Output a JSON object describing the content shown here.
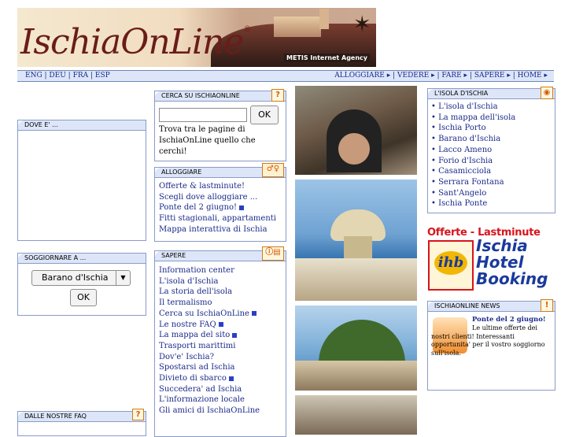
{
  "header": {
    "logo_text": "IschiaOnLine",
    "logo_reg": "®",
    "agency_label": "METIS Internet Agency"
  },
  "nav": {
    "languages": [
      "ENG",
      "DEU",
      "FRA",
      "ESP"
    ],
    "links": [
      "ALLOGGIARE",
      "VEDERE",
      "FARE",
      "SAPERE",
      "HOME"
    ]
  },
  "left": {
    "dove_title": "DOVE E' ...",
    "soggiornare_title": "SOGGIORNARE A ...",
    "soggiornare_selected": "Barano d'Ischia",
    "soggiornare_ok": "OK",
    "faq_title": "DALLE NOSTRE FAQ"
  },
  "search": {
    "title": "CERCA SU ISCHIAONLINE",
    "icon_glyph": "?",
    "value": "",
    "ok_label": "OK",
    "description": "Trova tra le pagine di IschiaOnLine quello che cerchi!"
  },
  "alloggiare": {
    "title": "ALLOGGIARE",
    "items": [
      {
        "label": "Offerte & lastminute!",
        "new": false
      },
      {
        "label": "Scegli dove alloggiare ...",
        "new": false
      },
      {
        "label": "Ponte del 2 giugno!",
        "new": true
      },
      {
        "label": "Fitti stagionali, appartamenti",
        "new": false
      },
      {
        "label": "Mappa interattiva di Ischia",
        "new": false
      }
    ]
  },
  "sapere": {
    "title": "SAPERE",
    "items": [
      {
        "label": "Information center",
        "new": false
      },
      {
        "label": "L'isola d'Ischia",
        "new": false
      },
      {
        "label": "La storia dell'isola",
        "new": false
      },
      {
        "label": "Il termalismo",
        "new": false
      },
      {
        "label": "Cerca su IschiaOnLine",
        "new": true
      },
      {
        "label": "Le nostre FAQ",
        "new": true
      },
      {
        "label": "La mappa del sito",
        "new": true
      },
      {
        "label": "Trasporti marittimi",
        "new": false
      },
      {
        "label": "Dov'e' Ischia?",
        "new": false
      },
      {
        "label": "Spostarsi ad Ischia",
        "new": false
      },
      {
        "label": "Divieto di sbarco",
        "new": true
      },
      {
        "label": "Succedera' ad Ischia",
        "new": false
      },
      {
        "label": "L'informazione locale",
        "new": false
      },
      {
        "label": "Gli amici di IschiaOnLine",
        "new": false
      }
    ]
  },
  "isola": {
    "title": "L'ISOLA D'ISCHIA",
    "items": [
      "L'isola d'Ischia",
      "La mappa dell'isola",
      "Ischia Porto",
      "Barano d'Ischia",
      "Lacco Ameno",
      "Forio d'Ischia",
      "Casamicciola",
      "Serrara Fontana",
      "Sant'Angelo",
      "Ischia Ponte"
    ]
  },
  "promo": {
    "headline": "Offerte - Lastminute",
    "logo_letters": "ihb",
    "line1": "Ischia",
    "line2": "Hotel",
    "line3": "Booking"
  },
  "news": {
    "title": "ISCHIAONLINE NEWS",
    "icon_glyph": "!",
    "headline": "Ponte del 2 giugno!",
    "text": "Le ultime offerte dei nostri clienti! Interessanti opportunita' per il vostro soggiorno sull'isola."
  },
  "colors": {
    "header_bg": "#dde6f8",
    "border": "#8a9bc7",
    "link": "#1a2a8a",
    "promo_red": "#d8141c",
    "promo_blue": "#1a3a9c"
  }
}
